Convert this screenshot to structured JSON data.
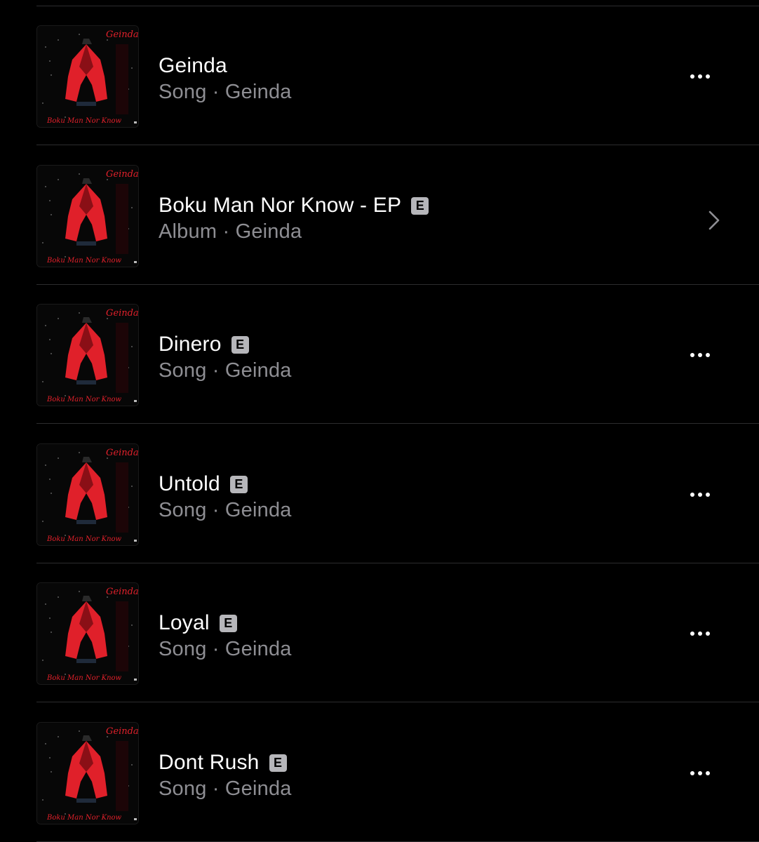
{
  "items": [
    {
      "title": "Geinda",
      "explicit": false,
      "subtitle": "Song · Geinda",
      "action": "more"
    },
    {
      "title": "Boku Man Nor Know - EP",
      "explicit": true,
      "subtitle": "Album · Geinda",
      "action": "chevron"
    },
    {
      "title": "Dinero",
      "explicit": true,
      "subtitle": "Song · Geinda",
      "action": "more"
    },
    {
      "title": "Untold",
      "explicit": true,
      "subtitle": "Song · Geinda",
      "action": "more"
    },
    {
      "title": "Loyal",
      "explicit": true,
      "subtitle": "Song · Geinda",
      "action": "more"
    },
    {
      "title": "Dont Rush",
      "explicit": true,
      "subtitle": "Song · Geinda",
      "action": "more"
    }
  ],
  "explicit_badge": "E",
  "artwork": {
    "artist_script": "Geinda",
    "album_script": "Boku Man Nor Know",
    "accent_color": "#e0202a"
  },
  "colors": {
    "background": "#000000",
    "title": "#ffffff",
    "subtitle": "#8e8e93",
    "divider": "#2c2c2e",
    "badge": "#b6b6ba"
  },
  "icons": {
    "more": "ellipsis-icon",
    "chevron": "chevron-right-icon",
    "explicit": "explicit-icon"
  }
}
